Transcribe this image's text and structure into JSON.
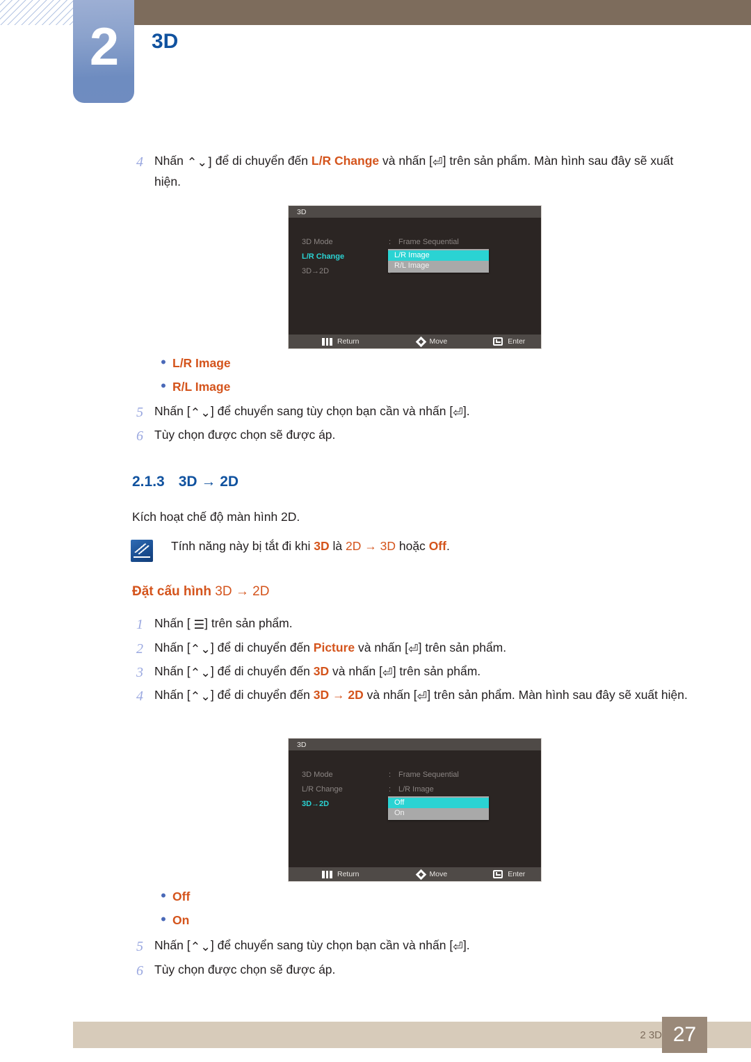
{
  "header": {
    "chapter_number": "2",
    "chapter_title": "3D"
  },
  "steps_top": [
    {
      "num": "4",
      "parts": [
        {
          "t": "Nhấn ",
          "s": "plain"
        },
        {
          "t": "⌃⌄]",
          "s": "key"
        },
        {
          "t": " để di chuyển đến ",
          "s": "plain"
        },
        {
          "t": "L/R Change",
          "s": "kw"
        },
        {
          "t": " và nhấn [",
          "s": "plain"
        },
        {
          "t": "⏎",
          "s": "key"
        },
        {
          "t": "] trên sản phẩm. Màn hình sau đây sẽ xuất hiện.",
          "s": "plain"
        }
      ]
    }
  ],
  "osd_first": {
    "title": "3D",
    "rows": [
      {
        "label": "3D Mode",
        "value": "Frame Sequential",
        "active": false
      },
      {
        "label": "L/R Change",
        "value": "",
        "active": true
      },
      {
        "label": "3D→2D",
        "value": "",
        "active": false
      }
    ],
    "dropdown": {
      "options": [
        {
          "label": "L/R Image",
          "selected": true
        },
        {
          "label": "R/L Image",
          "selected": false
        }
      ]
    },
    "footer": {
      "return": "Return",
      "move": "Move",
      "enter": "Enter"
    }
  },
  "bullets_first": [
    "L/R Image",
    "R/L Image"
  ],
  "steps_after_first": [
    {
      "num": "5",
      "parts": [
        {
          "t": "Nhấn [",
          "s": "plain"
        },
        {
          "t": "⌃⌄",
          "s": "key"
        },
        {
          "t": "] để chuyển sang tùy chọn bạn cần và nhấn [",
          "s": "plain"
        },
        {
          "t": "⏎",
          "s": "key"
        },
        {
          "t": "].",
          "s": "plain"
        }
      ]
    },
    {
      "num": "6",
      "parts": [
        {
          "t": "Tùy chọn được chọn sẽ được áp.",
          "s": "plain"
        }
      ]
    }
  ],
  "section": {
    "number": "2.1.3",
    "title": "3D → 2D"
  },
  "section_intro": "Kích hoạt chế độ màn hình 2D.",
  "note": {
    "parts": [
      {
        "t": "Tính năng này bị tắt đi khi ",
        "s": "plain"
      },
      {
        "t": "3D",
        "s": "kw"
      },
      {
        "t": " là ",
        "s": "plain"
      },
      {
        "t": "2D → ",
        "s": "kw-plain"
      },
      {
        "t": " 3D",
        "s": "kw-plain"
      },
      {
        "t": " hoặc ",
        "s": "plain"
      },
      {
        "t": "Off",
        "s": "kw"
      },
      {
        "t": ".",
        "s": "plain"
      }
    ]
  },
  "sub_heading": {
    "bold_part": "Đặt cấu hình",
    "rest": " 3D →  2D"
  },
  "steps_config": [
    {
      "num": "1",
      "parts": [
        {
          "t": "Nhấn [ ",
          "s": "plain"
        },
        {
          "t": "☰",
          "s": "key"
        },
        {
          "t": "] trên sản phẩm.",
          "s": "plain"
        }
      ]
    },
    {
      "num": "2",
      "parts": [
        {
          "t": "Nhấn [",
          "s": "plain"
        },
        {
          "t": "⌃⌄",
          "s": "key"
        },
        {
          "t": "] để di chuyển đến ",
          "s": "plain"
        },
        {
          "t": "Picture",
          "s": "kw"
        },
        {
          "t": " và nhấn [",
          "s": "plain"
        },
        {
          "t": "⏎",
          "s": "key"
        },
        {
          "t": "] trên sản phẩm.",
          "s": "plain"
        }
      ]
    },
    {
      "num": "3",
      "parts": [
        {
          "t": "Nhấn [",
          "s": "plain"
        },
        {
          "t": "⌃⌄",
          "s": "key"
        },
        {
          "t": "] để di chuyển đến ",
          "s": "plain"
        },
        {
          "t": "3D",
          "s": "kw"
        },
        {
          "t": " và nhấn [",
          "s": "plain"
        },
        {
          "t": "⏎",
          "s": "key"
        },
        {
          "t": "] trên sản phẩm.",
          "s": "plain"
        }
      ]
    },
    {
      "num": "4",
      "parts": [
        {
          "t": "Nhấn [",
          "s": "plain"
        },
        {
          "t": "⌃⌄",
          "s": "key"
        },
        {
          "t": "] để di chuyển đến ",
          "s": "plain"
        },
        {
          "t": "3D →  2D",
          "s": "kw"
        },
        {
          "t": " và nhấn [",
          "s": "plain"
        },
        {
          "t": "⏎",
          "s": "key"
        },
        {
          "t": "] trên sản phẩm. Màn hình sau đây sẽ xuất hiện.",
          "s": "plain"
        }
      ]
    }
  ],
  "osd_second": {
    "title": "3D",
    "rows": [
      {
        "label": "3D Mode",
        "value": "Frame Sequential",
        "active": false
      },
      {
        "label": "L/R Change",
        "value": "L/R Image",
        "active": false
      },
      {
        "label": "3D→2D",
        "value": "",
        "active": true
      }
    ],
    "dropdown": {
      "options": [
        {
          "label": "Off",
          "selected": true
        },
        {
          "label": "On",
          "selected": false
        }
      ]
    },
    "footer": {
      "return": "Return",
      "move": "Move",
      "enter": "Enter"
    }
  },
  "bullets_second": [
    "Off",
    "On"
  ],
  "steps_after_second": [
    {
      "num": "5",
      "parts": [
        {
          "t": "Nhấn [",
          "s": "plain"
        },
        {
          "t": "⌃⌄",
          "s": "key"
        },
        {
          "t": "] để chuyển sang tùy chọn bạn cần và nhấn [",
          "s": "plain"
        },
        {
          "t": "⏎",
          "s": "key"
        },
        {
          "t": "].",
          "s": "plain"
        }
      ]
    },
    {
      "num": "6",
      "parts": [
        {
          "t": "Tùy chọn được chọn sẽ được áp.",
          "s": "plain"
        }
      ]
    }
  ],
  "footer": {
    "label": "2 3D",
    "page": "27"
  },
  "colors": {
    "brand_blue": "#10529f",
    "accent_orange": "#d4541c",
    "header_brown": "#7d6c5c",
    "footer_beige": "#d7cbba",
    "osd_cyan": "#2ad3d3"
  }
}
